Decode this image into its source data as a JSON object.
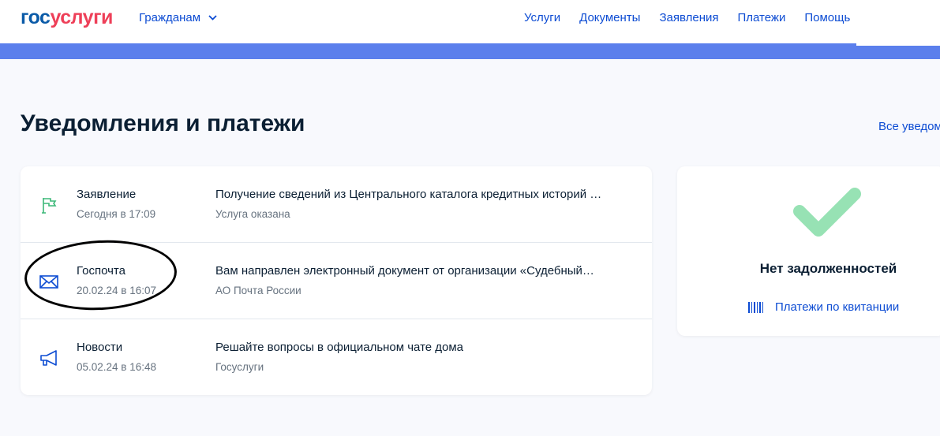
{
  "header": {
    "logo_part1": "гос",
    "logo_part2": "услуги",
    "citizens": "Гражданам",
    "nav": [
      "Услуги",
      "Документы",
      "Заявления",
      "Платежи",
      "Помощь"
    ]
  },
  "page_title": "Уведомления и платежи",
  "all_link": "Все уведомления",
  "notifications": [
    {
      "category": "Заявление",
      "date": "Сегодня в 17:09",
      "message": "Получение сведений из Центрального каталога кредитных историй …",
      "source": "Услуга оказана",
      "icon": "flag-icon"
    },
    {
      "category": "Госпочта",
      "date": "20.02.24 в 16:07",
      "message": "Вам направлен электронный документ от организации «Судебный…",
      "source": "АО Почта России",
      "icon": "envelope-icon"
    },
    {
      "category": "Новости",
      "date": "05.02.24 в 16:48",
      "message": "Решайте вопросы в официальном чате дома",
      "source": "Госуслуги",
      "icon": "megaphone-icon"
    }
  ],
  "payments": {
    "status": "Нет задолженностей",
    "link": "Платежи по квитанции"
  },
  "colors": {
    "accent": "#0d4cd3",
    "band": "#5b7fec",
    "check": "#97e2b4"
  }
}
